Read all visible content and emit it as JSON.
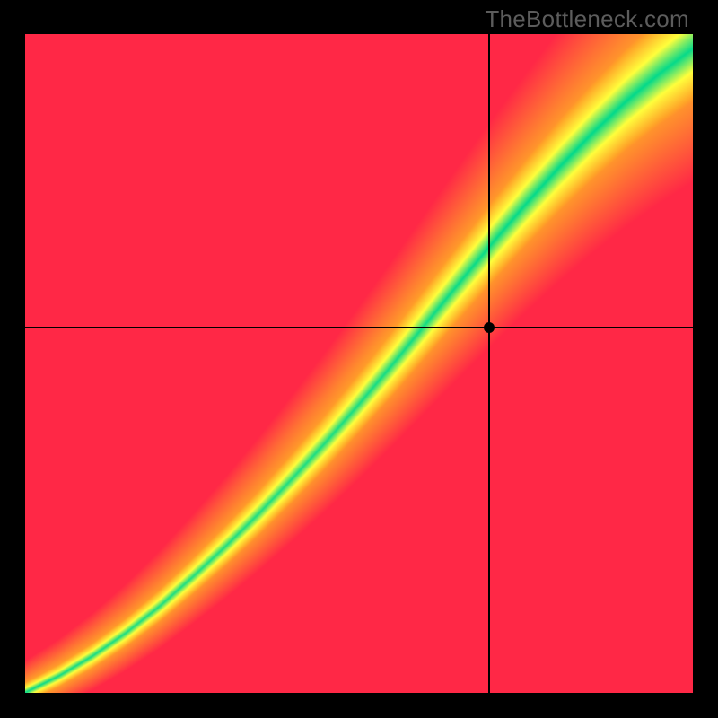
{
  "watermark": "TheBottleneck.com",
  "chart_data": {
    "type": "heatmap",
    "title": "",
    "xlabel": "",
    "ylabel": "",
    "xlim": [
      0,
      1
    ],
    "ylim": [
      0,
      1
    ],
    "crosshair": {
      "x": 0.695,
      "y": 0.555
    },
    "marker": {
      "x": 0.695,
      "y": 0.555
    },
    "optimal_curve": [
      {
        "x": 0.0,
        "y": 0.0
      },
      {
        "x": 0.05,
        "y": 0.025
      },
      {
        "x": 0.1,
        "y": 0.055
      },
      {
        "x": 0.15,
        "y": 0.09
      },
      {
        "x": 0.2,
        "y": 0.13
      },
      {
        "x": 0.25,
        "y": 0.175
      },
      {
        "x": 0.3,
        "y": 0.222
      },
      {
        "x": 0.35,
        "y": 0.272
      },
      {
        "x": 0.4,
        "y": 0.325
      },
      {
        "x": 0.45,
        "y": 0.38
      },
      {
        "x": 0.5,
        "y": 0.438
      },
      {
        "x": 0.55,
        "y": 0.498
      },
      {
        "x": 0.6,
        "y": 0.56
      },
      {
        "x": 0.65,
        "y": 0.622
      },
      {
        "x": 0.7,
        "y": 0.683
      },
      {
        "x": 0.75,
        "y": 0.742
      },
      {
        "x": 0.8,
        "y": 0.798
      },
      {
        "x": 0.85,
        "y": 0.85
      },
      {
        "x": 0.9,
        "y": 0.898
      },
      {
        "x": 0.95,
        "y": 0.94
      },
      {
        "x": 1.0,
        "y": 0.978
      }
    ],
    "band_halfwidth_lo": 0.015,
    "band_halfwidth_hi": 0.085,
    "colorscale": [
      {
        "t": 0.0,
        "color": "#00d98c"
      },
      {
        "t": 0.28,
        "color": "#ffff3c"
      },
      {
        "t": 0.6,
        "color": "#ffa428"
      },
      {
        "t": 1.0,
        "color": "#ff2846"
      }
    ],
    "note": "Values are normalized 0..1; axes have no visible ticks or labels in the image."
  },
  "colors": {
    "background": "#000000",
    "crosshair": "#000000",
    "marker": "#000000",
    "watermark": "#5c5c5c"
  }
}
